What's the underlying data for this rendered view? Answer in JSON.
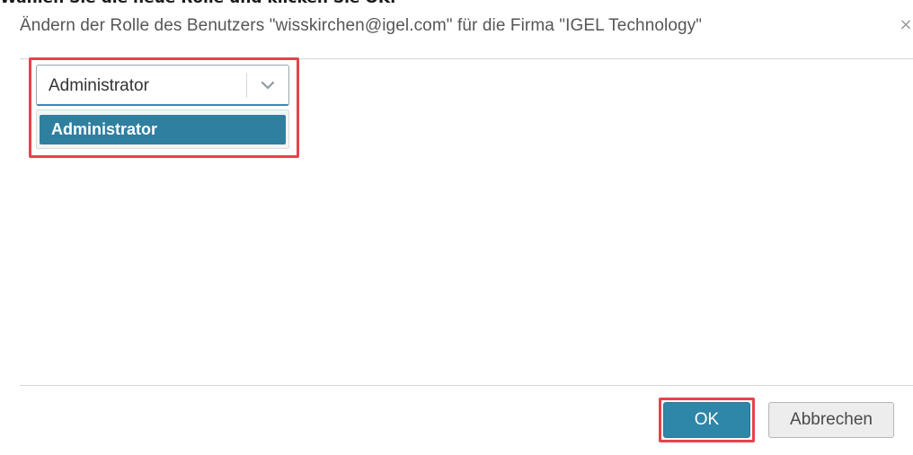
{
  "instruction": {
    "text": "Wählen Sie die neue Rolle und klicken Sie OK."
  },
  "dialog": {
    "title": "Ändern der Rolle des Benutzers \"wisskirchen@igel.com\" für die Firma \"IGEL Technology\"",
    "close_symbol": "×",
    "role_select": {
      "selected_value": "Administrator",
      "options": [
        "Administrator"
      ],
      "highlighted_option": "Administrator"
    },
    "buttons": {
      "ok_label": "OK",
      "cancel_label": "Abbrechen"
    }
  },
  "icons": {
    "close": "close-icon",
    "dropdown": "chevron-down-icon"
  },
  "colors": {
    "accent": "#2e86a8",
    "highlight": "#e8414b",
    "title_text": "#565656"
  }
}
